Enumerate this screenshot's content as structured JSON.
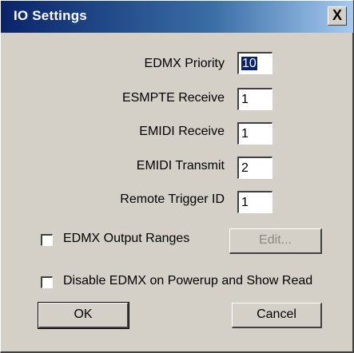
{
  "window": {
    "title": "IO Settings",
    "close_label": "X"
  },
  "fields": [
    {
      "label": "EDMX Priority",
      "value": "10"
    },
    {
      "label": "ESMPTE Receive",
      "value": "1"
    },
    {
      "label": "EMIDI Receive",
      "value": "1"
    },
    {
      "label": "EMIDI Transmit",
      "value": "2"
    },
    {
      "label": "Remote Trigger ID",
      "value": "1"
    }
  ],
  "options": {
    "output_ranges": {
      "label": "EDMX Output Ranges",
      "checked": false,
      "edit_label": "Edit..."
    },
    "disable_on_powerup": {
      "label": "Disable EDMX on Powerup and Show Read",
      "checked": false
    }
  },
  "buttons": {
    "ok": "OK",
    "cancel": "Cancel"
  }
}
